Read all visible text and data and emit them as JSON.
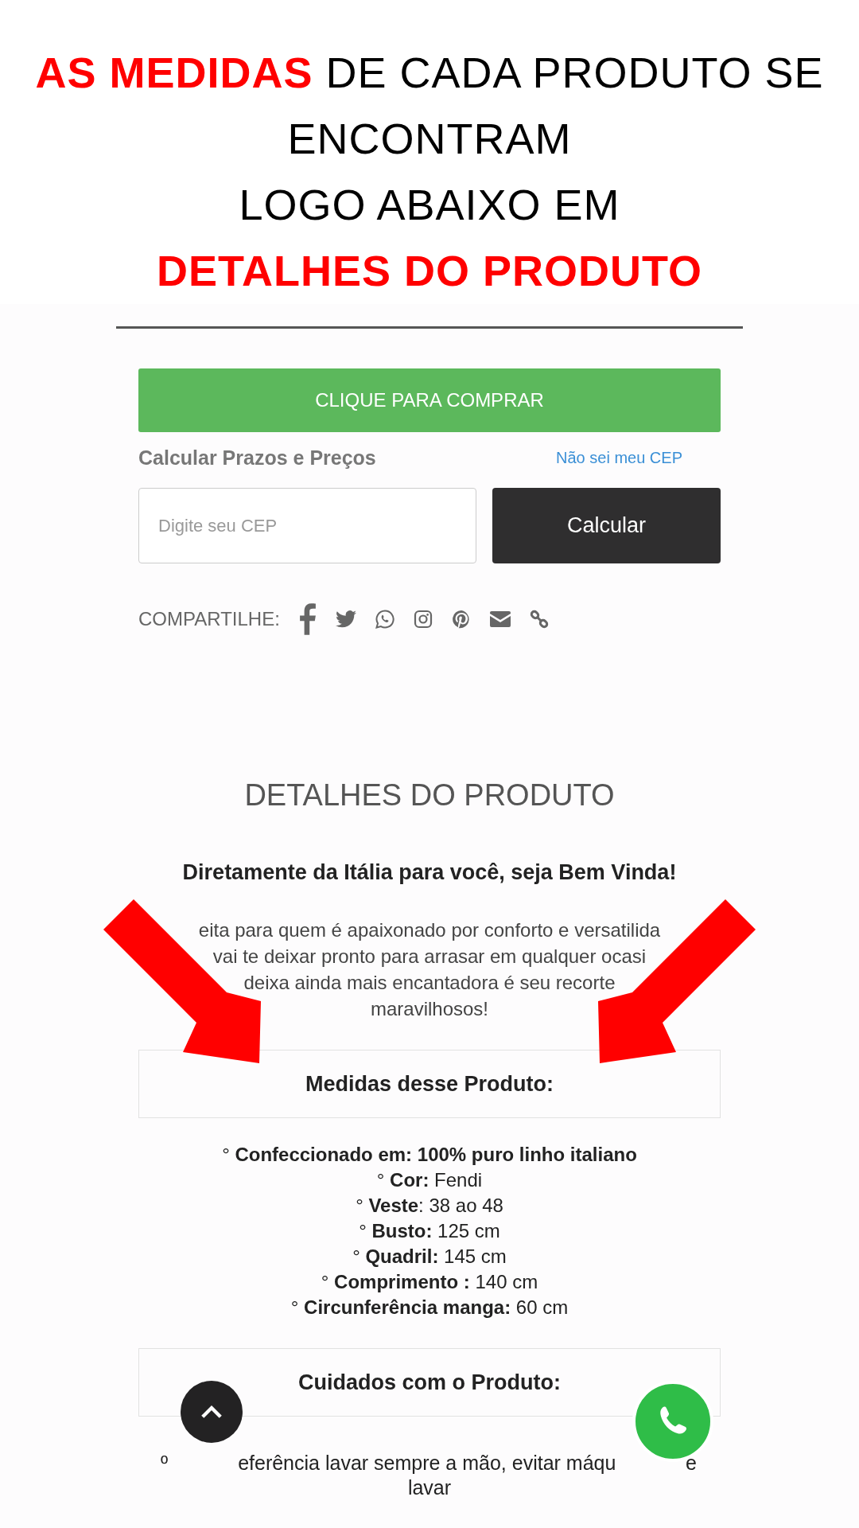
{
  "banner": {
    "lines": [
      "**AS MEDIDAS** DE CADA PRODUTO SE",
      "ENCONTRAM",
      "LOGO ABAIXO EM",
      "**DETALHES DO PRODUTO**"
    ]
  },
  "buy_button": {
    "label": "CLIQUE PARA COMPRAR"
  },
  "shipping": {
    "title": "Calcular Prazos e Preços",
    "help_link": "Não sei meu CEP",
    "cep_field": {
      "placeholder": "Digite seu CEP"
    },
    "calc_button": "Calcular"
  },
  "share": {
    "label": "COMPARTILHE:",
    "icons": [
      {
        "kind": "facebook"
      },
      {
        "kind": "twitter"
      },
      {
        "kind": "whatsapp"
      },
      {
        "kind": "instagram"
      },
      {
        "kind": "pinterest"
      },
      {
        "kind": "email"
      },
      {
        "kind": "link"
      }
    ]
  },
  "details": {
    "heading": "DETALHES DO PRODUTO",
    "welcome": "Diretamente da Itália para você, seja Bem Vinda!",
    "intro_lines": [
      "eita para quem é apaixonado por conforto e versatilida",
      "vai te deixar pronto para arrasar em qualquer ocasi",
      "deixa ainda mais encantadora é seu recorte",
      "maravilhosos!"
    ],
    "measures_title": "Medidas desse Produto:",
    "measures": [
      "° **Confeccionado em: 100% puro linho italiano**",
      "° **Cor:** Fendi",
      "° **Veste**: 38 ao 48",
      "° **Busto:** 125 cm",
      "° **Quadril:** 145 cm",
      "° **Comprimento :** 140 cm",
      "° **Circunferência manga:** 60 cm"
    ],
    "care_title": "Cuidados com o Produto:",
    "care_line": [
      "º",
      "eferência lavar sempre a mão, evitar máqu",
      "e"
    ],
    "care_line_2": "lavar"
  }
}
